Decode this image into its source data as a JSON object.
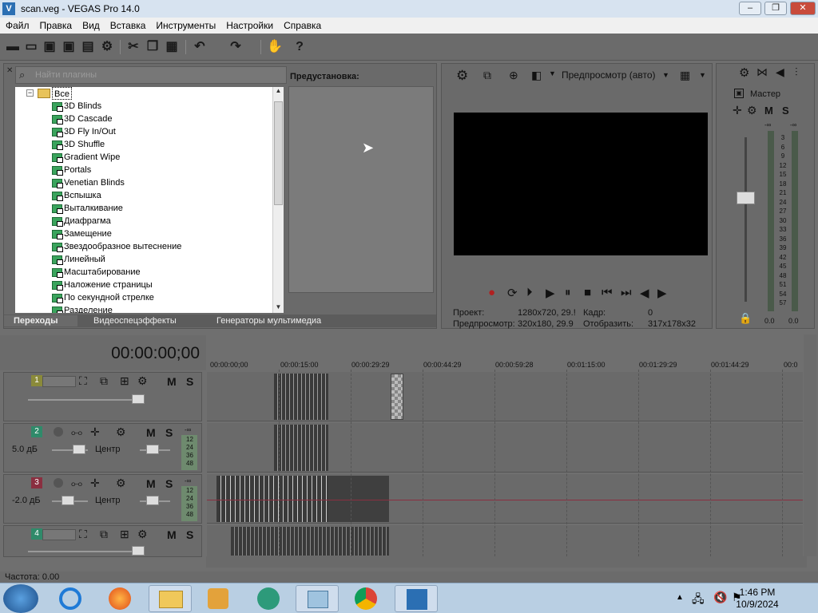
{
  "window": {
    "title": "scan.veg - VEGAS Pro 14.0"
  },
  "menu": [
    "Файл",
    "Правка",
    "Вид",
    "Вставка",
    "Инструменты",
    "Настройки",
    "Справка"
  ],
  "plugins": {
    "search_placeholder": "Найти плагины",
    "root": "Все",
    "items": [
      "3D Blinds",
      "3D Cascade",
      "3D Fly In/Out",
      "3D Shuffle",
      "Gradient Wipe",
      "Portals",
      "Venetian Blinds",
      "Вспышка",
      "Выталкивание",
      "Диафрагма",
      "Замещение",
      "Звездообразное вытеснение",
      "Линейный",
      "Масштабирование",
      "Наложение страницы",
      "По секундной стрелке",
      "Разделение"
    ],
    "presets_label": "Предустановка:",
    "tabs": [
      "Переходы",
      "Видеоспецэффекты",
      "Генераторы мультимедиа"
    ]
  },
  "preview": {
    "mode": "Предпросмотр (авто)",
    "project_label": "Проект:",
    "project_value": "1280x720, 29.!",
    "frame_label": "Кадр:",
    "frame_value": "0",
    "preview_label": "Предпросмотр:",
    "preview_value": "320x180, 29.9",
    "display_label": "Отобразить:",
    "display_value": "317x178x32"
  },
  "mixer": {
    "master_label": "Мастер",
    "m_label": "M",
    "s_label": "S",
    "db_scale": [
      "3",
      "6",
      "9",
      "12",
      "15",
      "18",
      "21",
      "24",
      "27",
      "30",
      "33",
      "36",
      "39",
      "42",
      "45",
      "48",
      "51",
      "54",
      "57"
    ],
    "inf": "-∞",
    "left_value": "0.0",
    "right_value": "0.0"
  },
  "timeline": {
    "timecode": "00:00:00;00",
    "ruler": [
      "00:00:00;00",
      "00:00:15:00",
      "00:00:29:29",
      "00:00:44:29",
      "00:00:59:28",
      "00:01:15:00",
      "00:01:29:29",
      "00:01:44:29",
      "00:0"
    ],
    "tracks": [
      {
        "num": "1",
        "type": "video",
        "color": "#8a8a3a"
      },
      {
        "num": "2",
        "type": "audio",
        "color": "#2f8a6a",
        "volume": "5.0 дБ",
        "pan": "Центр",
        "meter": [
          "12",
          "24",
          "36",
          "48"
        ]
      },
      {
        "num": "3",
        "type": "audio",
        "color": "#8a2f40",
        "volume": "-2.0 дБ",
        "pan": "Центр",
        "meter": [
          "12",
          "24",
          "36",
          "48"
        ]
      },
      {
        "num": "4",
        "type": "video",
        "color": "#2f8a6a"
      }
    ],
    "m_label": "M",
    "s_label": "S"
  },
  "status": {
    "rate": "Частота: 0.00"
  },
  "taskbar": {
    "time": "1:46 PM",
    "date": "10/9/2024"
  }
}
